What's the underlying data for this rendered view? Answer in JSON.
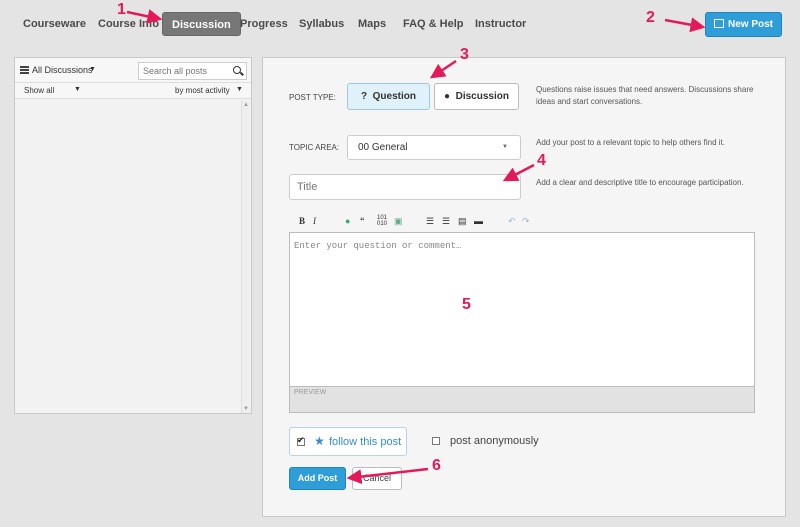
{
  "nav": {
    "tabs": [
      {
        "label": "Courseware"
      },
      {
        "label": "Course Info"
      },
      {
        "label": "Discussion"
      },
      {
        "label": "Progress"
      },
      {
        "label": "Syllabus"
      },
      {
        "label": "Maps"
      },
      {
        "label": "FAQ & Help"
      },
      {
        "label": "Instructor"
      }
    ],
    "active_tab": "Discussion",
    "new_post_label": "New Post"
  },
  "sidebar": {
    "filter_label": "All Discussions",
    "search_placeholder": "Search all posts",
    "show_label": "Show all",
    "sort_label": "by most activity"
  },
  "form": {
    "post_type_label": "POST TYPE:",
    "question_label": "Question",
    "discussion_label": "Discussion",
    "post_type_help": "Questions raise issues that need answers. Discussions share ideas and start conversations.",
    "topic_label": "TOPIC AREA:",
    "topic_value": "00 General",
    "topic_help": "Add your post to a relevant topic to help others find it.",
    "title_placeholder": "Title",
    "title_help": "Add a clear and descriptive title to encourage participation.",
    "editor_placeholder": "Enter your question or comment…",
    "preview_label": "PREVIEW",
    "follow_label": "follow this post",
    "follow_checked": true,
    "anonymous_label": "post anonymously",
    "anonymous_checked": false,
    "add_post_label": "Add Post",
    "cancel_label": "Cancel"
  },
  "annotations": [
    "1",
    "2",
    "3",
    "4",
    "5",
    "6"
  ],
  "colors": {
    "annotation": "#e4195a",
    "primary_button": "#2f9ed8",
    "selected_type": "#dff1f9",
    "link": "#2f8fcf"
  }
}
